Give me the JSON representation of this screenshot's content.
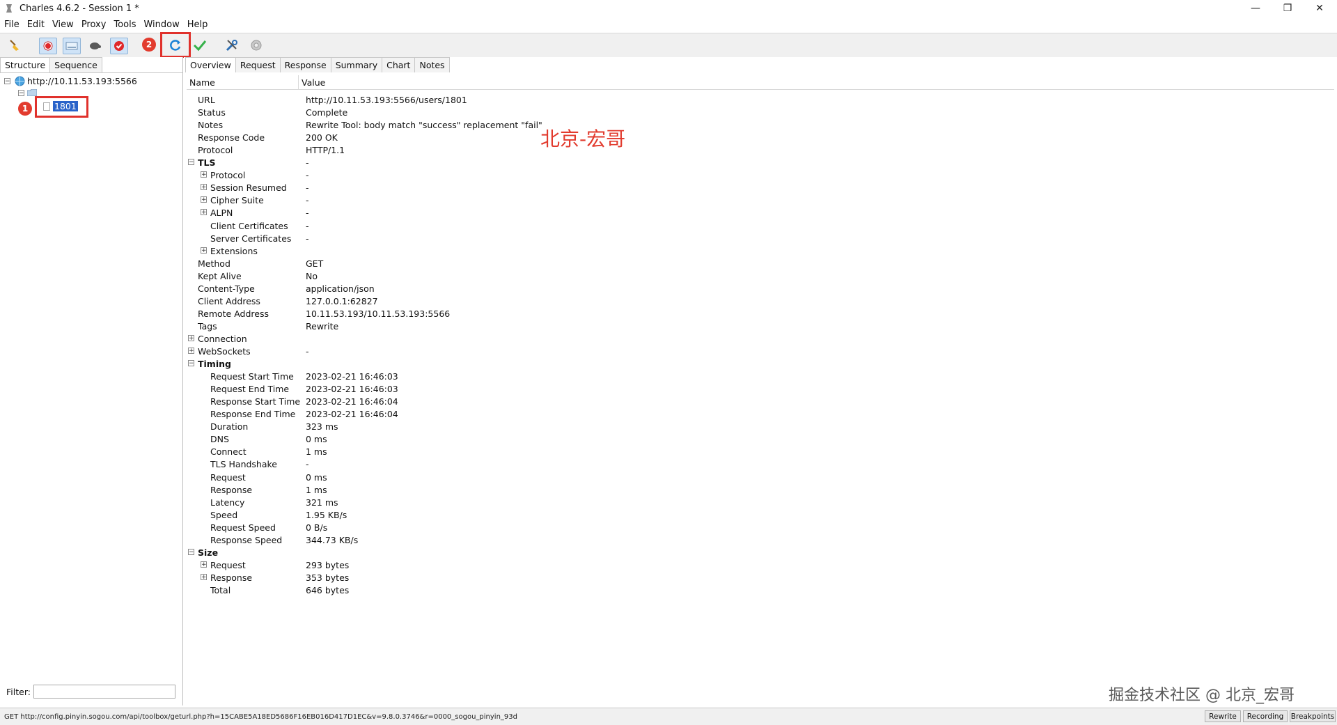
{
  "window": {
    "title": "Charles 4.6.2 - Session 1 *"
  },
  "menu": [
    "File",
    "Edit",
    "View",
    "Proxy",
    "Tools",
    "Window",
    "Help"
  ],
  "toolbar": {
    "icons": [
      "broom-icon",
      "record-icon",
      "throttle-icon",
      "turtle-icon",
      "breakpoint-icon",
      "repeat-icon",
      "validate-icon",
      "tools-icon",
      "settings-icon"
    ],
    "badge2": "2"
  },
  "left": {
    "tabs": [
      "Structure",
      "Sequence"
    ],
    "host": "http://10.11.53.193:5566",
    "node": "1801",
    "badge1": "1",
    "filter_label": "Filter:",
    "filter_value": ""
  },
  "right": {
    "tabs": [
      "Overview",
      "Request",
      "Response",
      "Summary",
      "Chart",
      "Notes"
    ],
    "col_name": "Name",
    "col_value": "Value",
    "rows": [
      {
        "name": "URL",
        "value": "http://10.11.53.193:5566/users/1801"
      },
      {
        "name": "Status",
        "value": "Complete"
      },
      {
        "name": "Notes",
        "value": "Rewrite Tool: body match \"success\" replacement \"fail\""
      },
      {
        "name": "Response Code",
        "value": "200 OK"
      },
      {
        "name": "Protocol",
        "value": "HTTP/1.1"
      },
      {
        "name": "TLS",
        "value": "-"
      },
      {
        "name": "Protocol",
        "value": "-"
      },
      {
        "name": "Session Resumed",
        "value": "-"
      },
      {
        "name": "Cipher Suite",
        "value": "-"
      },
      {
        "name": "ALPN",
        "value": "-"
      },
      {
        "name": "Client Certificates",
        "value": "-"
      },
      {
        "name": "Server Certificates",
        "value": "-"
      },
      {
        "name": "Extensions",
        "value": ""
      },
      {
        "name": "Method",
        "value": "GET"
      },
      {
        "name": "Kept Alive",
        "value": "No"
      },
      {
        "name": "Content-Type",
        "value": "application/json"
      },
      {
        "name": "Client Address",
        "value": "127.0.0.1:62827"
      },
      {
        "name": "Remote Address",
        "value": "10.11.53.193/10.11.53.193:5566"
      },
      {
        "name": "Tags",
        "value": "Rewrite"
      },
      {
        "name": "Connection",
        "value": ""
      },
      {
        "name": "WebSockets",
        "value": "-"
      },
      {
        "name": "Timing",
        "value": ""
      },
      {
        "name": "Request Start Time",
        "value": "2023-02-21 16:46:03"
      },
      {
        "name": "Request End Time",
        "value": "2023-02-21 16:46:03"
      },
      {
        "name": "Response Start Time",
        "value": "2023-02-21 16:46:04"
      },
      {
        "name": "Response End Time",
        "value": "2023-02-21 16:46:04"
      },
      {
        "name": "Duration",
        "value": "323 ms"
      },
      {
        "name": "DNS",
        "value": "0 ms"
      },
      {
        "name": "Connect",
        "value": "1 ms"
      },
      {
        "name": "TLS Handshake",
        "value": "-"
      },
      {
        "name": "Request",
        "value": "0 ms"
      },
      {
        "name": "Response",
        "value": "1 ms"
      },
      {
        "name": "Latency",
        "value": "321 ms"
      },
      {
        "name": "Speed",
        "value": "1.95 KB/s"
      },
      {
        "name": "Request Speed",
        "value": "0 B/s"
      },
      {
        "name": "Response Speed",
        "value": "344.73 KB/s"
      },
      {
        "name": "Size",
        "value": ""
      },
      {
        "name": "Request",
        "value": "293 bytes"
      },
      {
        "name": "Response",
        "value": "353 bytes"
      },
      {
        "name": "Total",
        "value": "646 bytes"
      }
    ]
  },
  "watermarks": {
    "red": "北京-宏哥",
    "gray": "掘金技术社区 @ 北京_宏哥"
  },
  "status": {
    "message": "GET http://config.pinyin.sogou.com/api/toolbox/geturl.php?h=15CABE5A18ED5686F16EB016D417D1EC&v=9.8.0.3746&r=0000_sogou_pinyin_93d",
    "buttons": [
      "Rewrite",
      "Recording",
      "Breakpoints"
    ]
  }
}
